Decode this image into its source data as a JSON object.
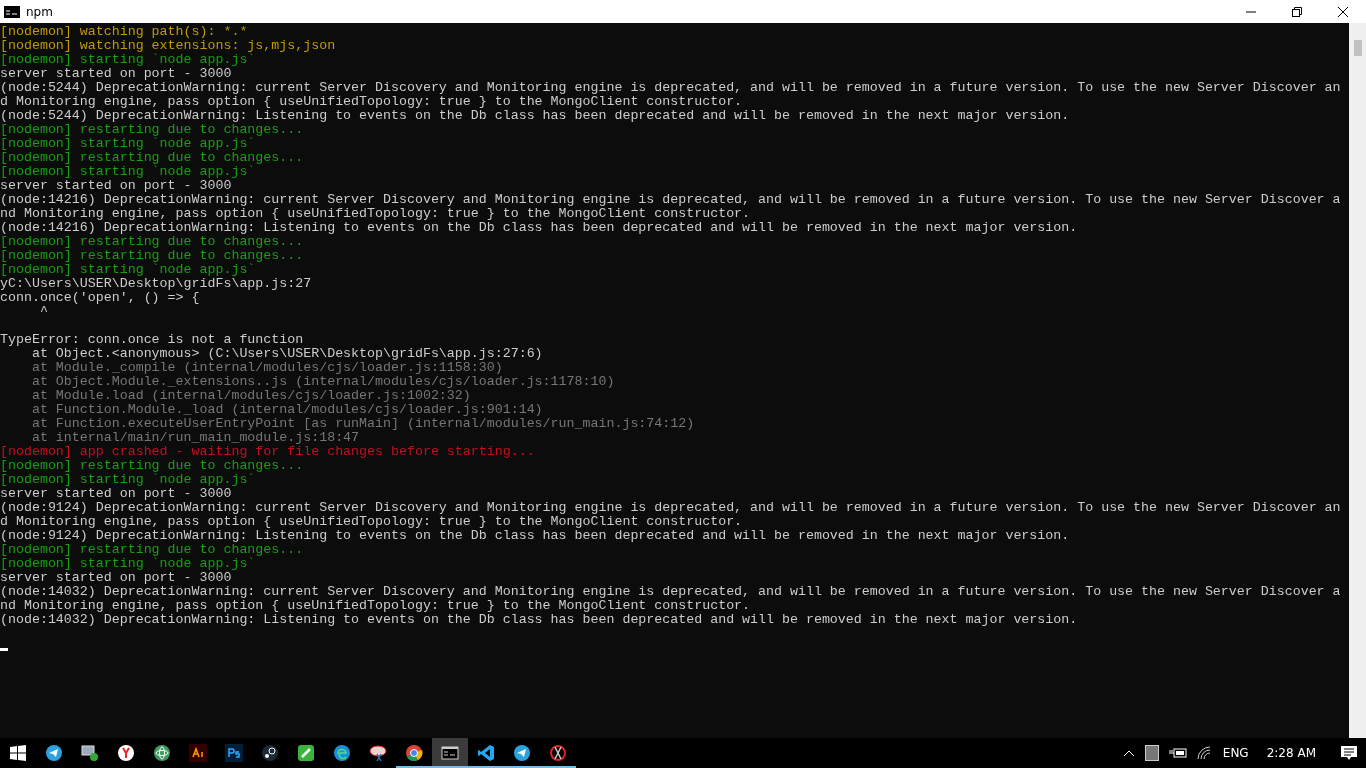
{
  "window": {
    "title": "npm"
  },
  "console": {
    "lines": [
      {
        "kind": "watch",
        "text": "[nodemon] watching path(s): *.*"
      },
      {
        "kind": "watch",
        "text": "[nodemon] watching extensions: js,mjs,json"
      },
      {
        "kind": "nodemon",
        "text": "[nodemon] starting `node app.js`"
      },
      {
        "kind": "plain",
        "text": "server started on port - 3000"
      },
      {
        "kind": "plain",
        "text": "(node:5244) DeprecationWarning: current Server Discovery and Monitoring engine is deprecated, and will be removed in a future version. To use the new Server Discover an"
      },
      {
        "kind": "plain",
        "text": "d Monitoring engine, pass option { useUnifiedTopology: true } to the MongoClient constructor."
      },
      {
        "kind": "plain",
        "text": "(node:5244) DeprecationWarning: Listening to events on the Db class has been deprecated and will be removed in the next major version."
      },
      {
        "kind": "nodemon",
        "text": "[nodemon] restarting due to changes..."
      },
      {
        "kind": "nodemon",
        "text": "[nodemon] starting `node app.js`"
      },
      {
        "kind": "nodemon",
        "text": "[nodemon] restarting due to changes..."
      },
      {
        "kind": "nodemon",
        "text": "[nodemon] starting `node app.js`"
      },
      {
        "kind": "plain",
        "text": "server started on port - 3000"
      },
      {
        "kind": "plain",
        "text": "(node:14216) DeprecationWarning: current Server Discovery and Monitoring engine is deprecated, and will be removed in a future version. To use the new Server Discover a"
      },
      {
        "kind": "plain",
        "text": "nd Monitoring engine, pass option { useUnifiedTopology: true } to the MongoClient constructor."
      },
      {
        "kind": "plain",
        "text": "(node:14216) DeprecationWarning: Listening to events on the Db class has been deprecated and will be removed in the next major version."
      },
      {
        "kind": "nodemon",
        "text": "[nodemon] restarting due to changes..."
      },
      {
        "kind": "nodemon",
        "text": "[nodemon] restarting due to changes..."
      },
      {
        "kind": "nodemon",
        "text": "[nodemon] starting `node app.js`"
      },
      {
        "kind": "plain",
        "text": "yC:\\Users\\USER\\Desktop\\gridFs\\app.js:27"
      },
      {
        "kind": "plain",
        "text": "conn.once('open', () => {"
      },
      {
        "kind": "plain",
        "text": "     ^"
      },
      {
        "kind": "blank"
      },
      {
        "kind": "plain",
        "text": "TypeError: conn.once is not a function"
      },
      {
        "kind": "plain",
        "text": "    at Object.<anonymous> (C:\\Users\\USER\\Desktop\\gridFs\\app.js:27:6)"
      },
      {
        "kind": "stack",
        "text": "    at Module._compile (internal/modules/cjs/loader.js:1158:30)"
      },
      {
        "kind": "stack",
        "text": "    at Object.Module._extensions..js (internal/modules/cjs/loader.js:1178:10)"
      },
      {
        "kind": "stack",
        "text": "    at Module.load (internal/modules/cjs/loader.js:1002:32)"
      },
      {
        "kind": "stack",
        "text": "    at Function.Module._load (internal/modules/cjs/loader.js:901:14)"
      },
      {
        "kind": "stack",
        "text": "    at Function.executeUserEntryPoint [as runMain] (internal/modules/run_main.js:74:12)"
      },
      {
        "kind": "stack",
        "text": "    at internal/main/run_main_module.js:18:47"
      },
      {
        "kind": "error",
        "text": "[nodemon] app crashed - waiting for file changes before starting..."
      },
      {
        "kind": "nodemon",
        "text": "[nodemon] restarting due to changes..."
      },
      {
        "kind": "nodemon",
        "text": "[nodemon] starting `node app.js`"
      },
      {
        "kind": "plain",
        "text": "server started on port - 3000"
      },
      {
        "kind": "plain",
        "text": "(node:9124) DeprecationWarning: current Server Discovery and Monitoring engine is deprecated, and will be removed in a future version. To use the new Server Discover an"
      },
      {
        "kind": "plain",
        "text": "d Monitoring engine, pass option { useUnifiedTopology: true } to the MongoClient constructor."
      },
      {
        "kind": "plain",
        "text": "(node:9124) DeprecationWarning: Listening to events on the Db class has been deprecated and will be removed in the next major version."
      },
      {
        "kind": "nodemon",
        "text": "[nodemon] restarting due to changes..."
      },
      {
        "kind": "nodemon",
        "text": "[nodemon] starting `node app.js`"
      },
      {
        "kind": "plain",
        "text": "server started on port - 3000"
      },
      {
        "kind": "plain",
        "text": "(node:14032) DeprecationWarning: current Server Discovery and Monitoring engine is deprecated, and will be removed in a future version. To use the new Server Discover a"
      },
      {
        "kind": "plain",
        "text": "nd Monitoring engine, pass option { useUnifiedTopology: true } to the MongoClient constructor."
      },
      {
        "kind": "plain",
        "text": "(node:14032) DeprecationWarning: Listening to events on the Db class has been deprecated and will be removed in the next major version."
      },
      {
        "kind": "blank"
      },
      {
        "kind": "cursor"
      }
    ]
  },
  "taskbar": {
    "apps": [
      {
        "kind": "telegram",
        "running": false,
        "selected": false
      },
      {
        "kind": "remote",
        "running": false,
        "selected": false
      },
      {
        "kind": "yandex",
        "running": false,
        "selected": false
      },
      {
        "kind": "atom",
        "running": false,
        "selected": false
      },
      {
        "kind": "illustrator",
        "running": false,
        "selected": false
      },
      {
        "kind": "photoshop",
        "running": false,
        "selected": false
      },
      {
        "kind": "steam",
        "running": false,
        "selected": false
      },
      {
        "kind": "pen",
        "running": false,
        "selected": false
      },
      {
        "kind": "edge",
        "running": false,
        "selected": false
      },
      {
        "kind": "snip",
        "running": false,
        "selected": false
      },
      {
        "kind": "chrome",
        "running": true,
        "selected": false
      },
      {
        "kind": "cmd",
        "running": true,
        "selected": true
      },
      {
        "kind": "vscode",
        "running": true,
        "selected": false
      },
      {
        "kind": "telegram",
        "running": true,
        "selected": false
      },
      {
        "kind": "scissors",
        "running": true,
        "selected": false
      }
    ],
    "language": "ENG",
    "time": "2:28 AM"
  }
}
